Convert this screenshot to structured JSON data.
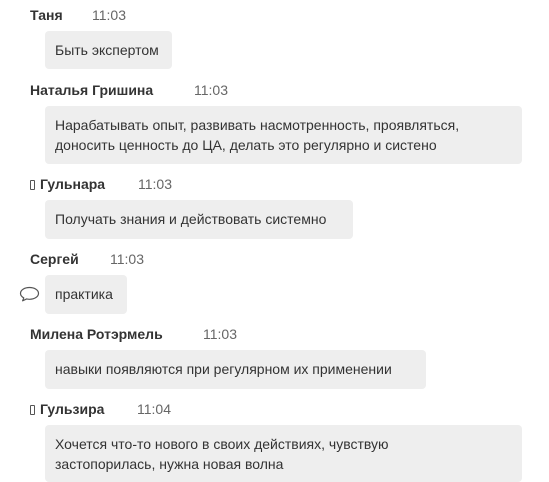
{
  "messages": [
    {
      "name": "Таня",
      "time": "11:03",
      "text": "Быть экспертом",
      "mobile": false
    },
    {
      "name": "Наталья Гришина",
      "time": "11:03",
      "text": "Нарабатывать опыт, развивать насмотренность, проявляться,\nдоносить ценность до ЦА, делать это регулярно и систено",
      "mobile": false
    },
    {
      "name": "Гульнара",
      "time": "11:03",
      "text": "Получать знания и действовать системно",
      "mobile": true
    },
    {
      "name": "Сергей",
      "time": "11:03",
      "text": "практика",
      "mobile": false
    },
    {
      "name": "Милена Ротэрмель",
      "time": "11:03",
      "text": "навыки появляются при регулярном их применении",
      "mobile": false
    },
    {
      "name": "Гульзира",
      "time": "11:04",
      "text": "Хочется что-то нового в своих действиях, чувствую\nзастопорилась, нужна новая волна",
      "mobile": true
    }
  ],
  "icons": {
    "mobile": "phone-icon",
    "comment": "comment-icon"
  },
  "colors": {
    "bubble": "#eeeeee",
    "name": "#333333",
    "time": "#666666"
  }
}
